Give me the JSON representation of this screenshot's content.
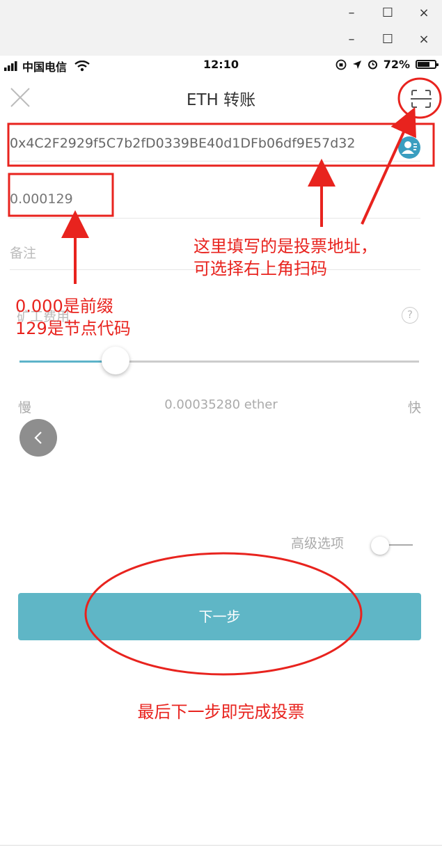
{
  "window_chrome": {
    "minimize_label": "–",
    "maximize_label": "☐",
    "close_label": "×"
  },
  "status_bar": {
    "carrier": "中国电信",
    "time": "12:10",
    "battery_percent": "72%",
    "battery_level": 0.72
  },
  "header": {
    "title": "ETH 转账"
  },
  "form": {
    "address_value": "0x4C2F2929f5C7b2fD0339BE40d1DFb06df9E57d32",
    "amount_value": "0.000129",
    "memo_placeholder": "备注",
    "fee_label": "矿工费用",
    "fee_slider_level": 0.24,
    "slow_label": "慢",
    "fee_value": "0.00035280 ether",
    "fast_label": "快",
    "help_label": "?",
    "advanced_label": "高级选项",
    "advanced_enabled": false,
    "next_button_label": "下一步"
  },
  "annotations": {
    "address_note_line1": "这里填写的是投票地址，",
    "address_note_line2": "可选择右上角扫码",
    "amount_note_line1": "0.000是前缀",
    "amount_note_line2": "129是节点代码",
    "final_note": "最后下一步即完成投票"
  },
  "colors": {
    "accent": "#5fb6c6",
    "annotation": "#e8231e"
  }
}
